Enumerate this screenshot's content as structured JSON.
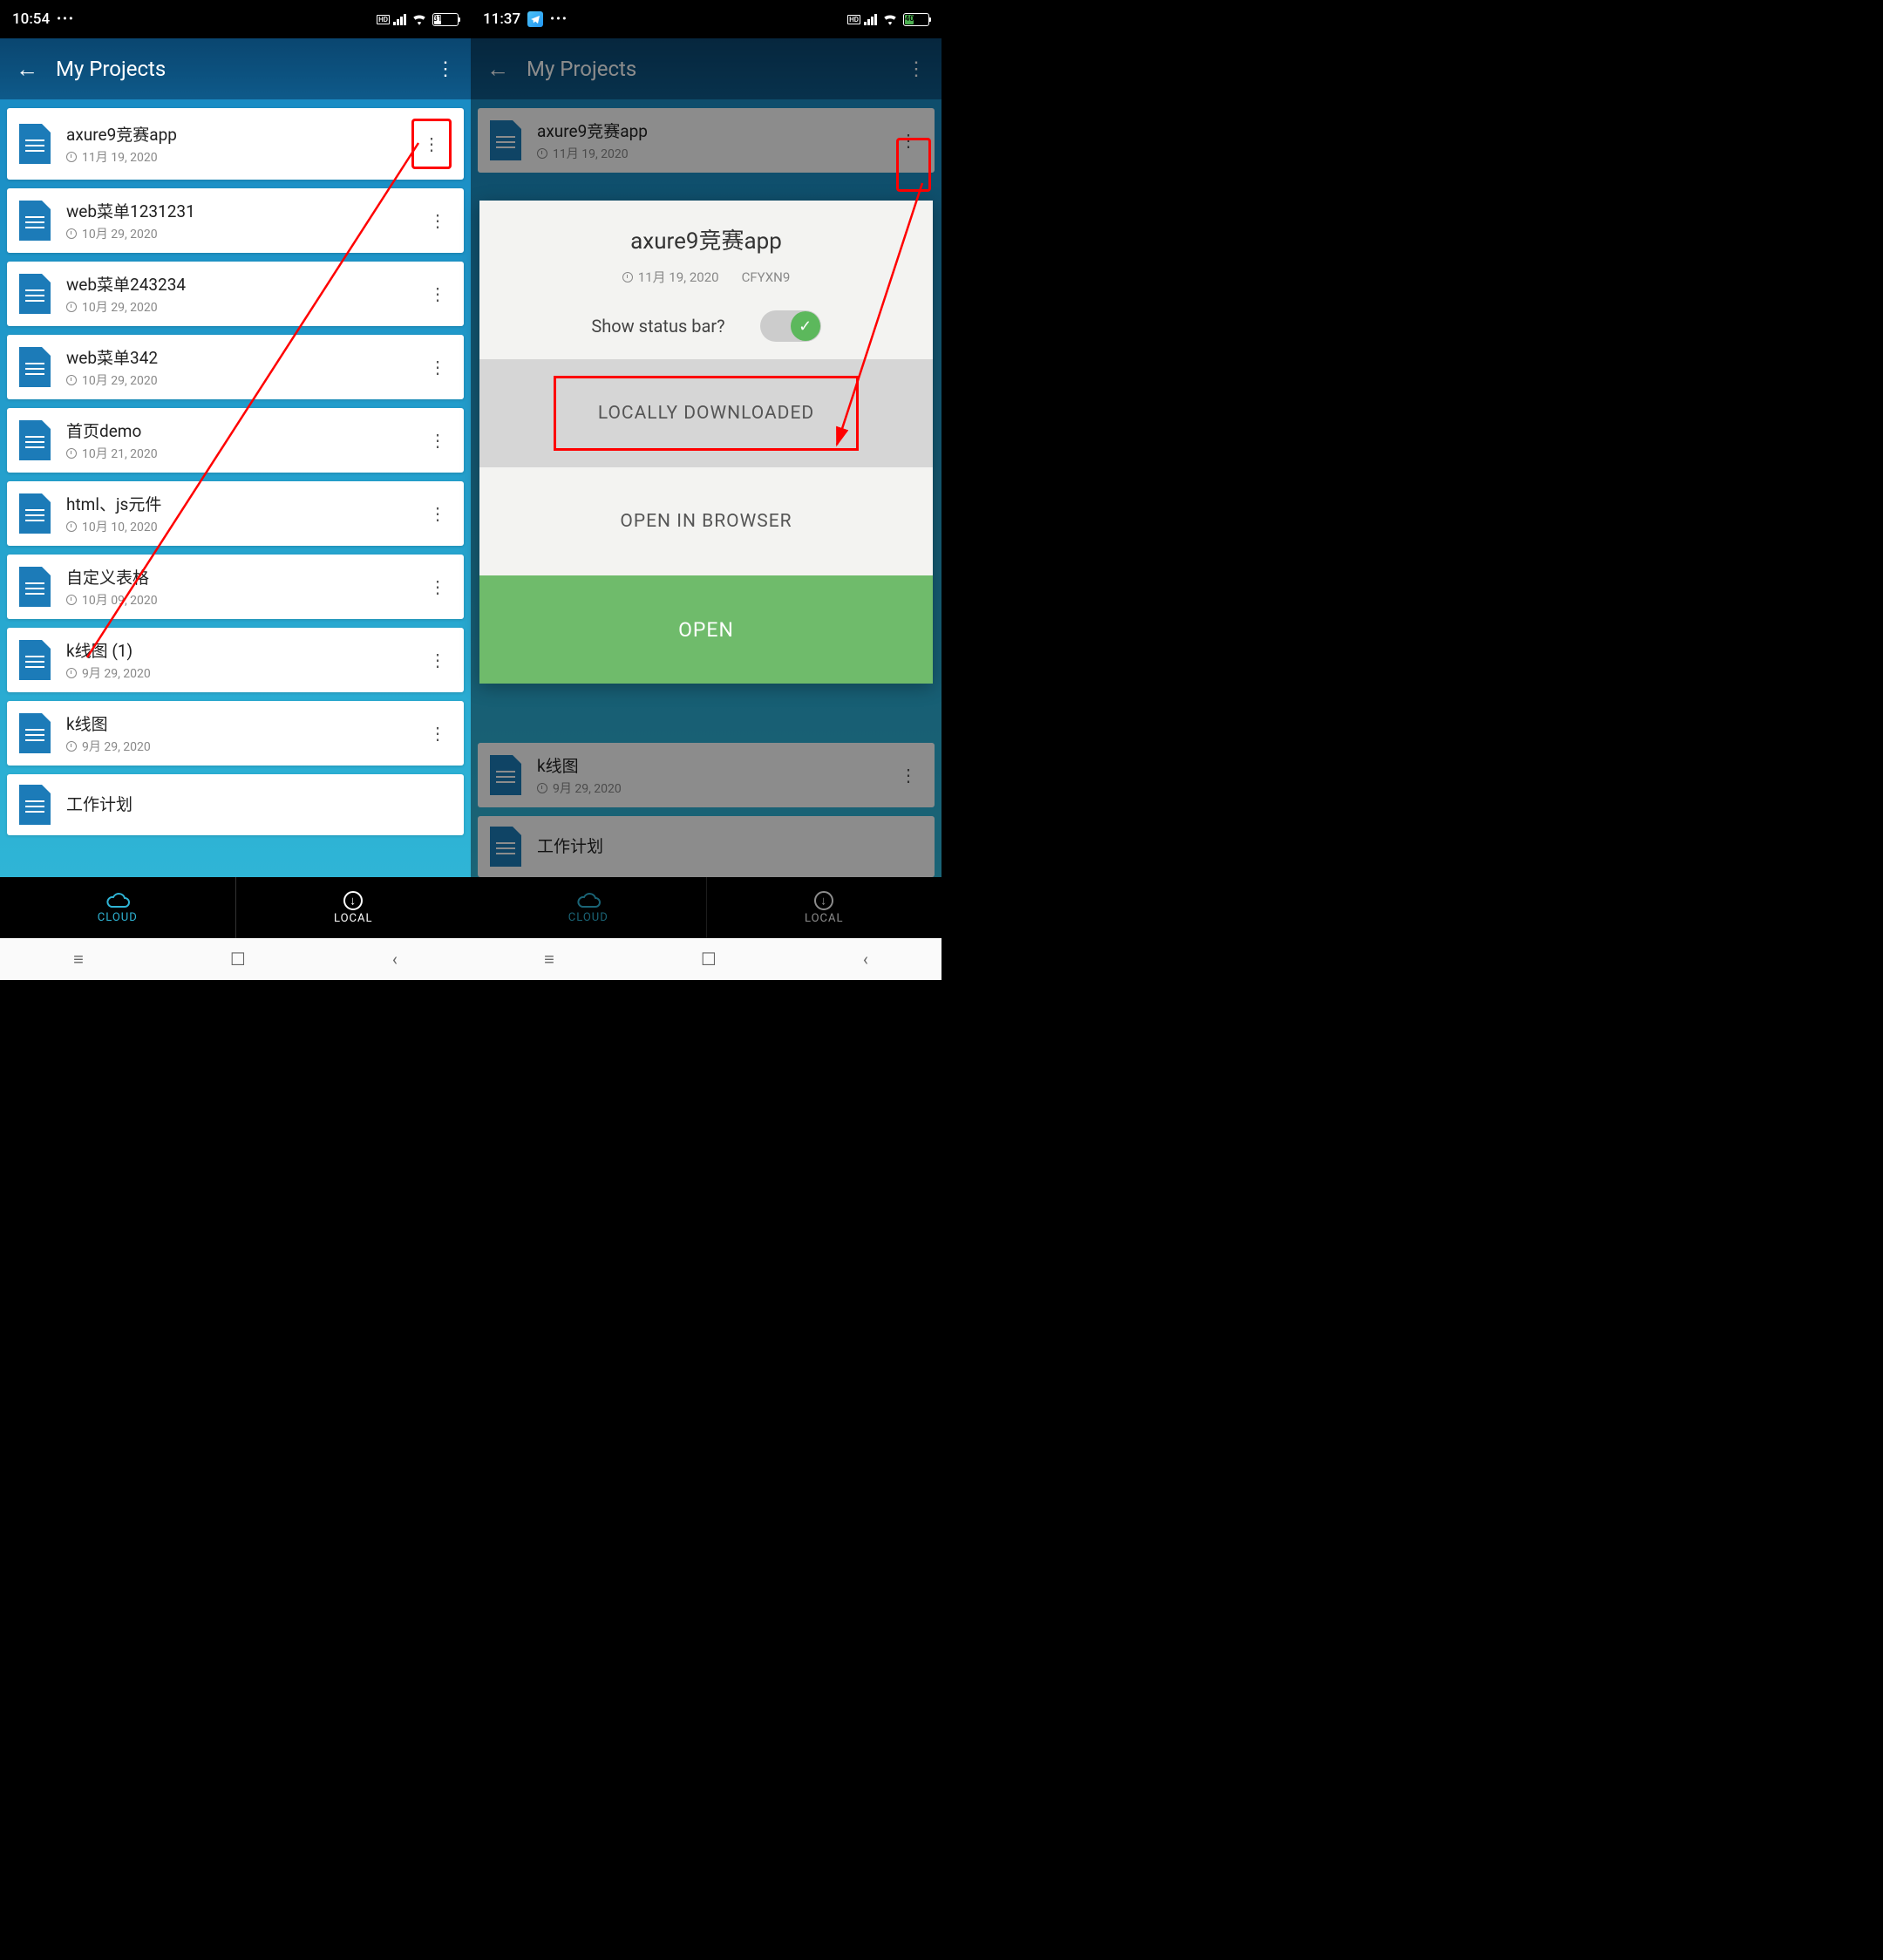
{
  "left": {
    "status": {
      "time": "10:54",
      "battery_pct": "31"
    },
    "header": {
      "title": "My Projects"
    },
    "projects": [
      {
        "title": "axure9竞赛app",
        "date": "11月 19, 2020"
      },
      {
        "title": "web菜单1231231",
        "date": "10月 29, 2020"
      },
      {
        "title": "web菜单243234",
        "date": "10月 29, 2020"
      },
      {
        "title": "web菜单342",
        "date": "10月 29, 2020"
      },
      {
        "title": "首页demo",
        "date": "10月 21, 2020"
      },
      {
        "title": "html、js元件",
        "date": "10月 10, 2020"
      },
      {
        "title": "自定义表格",
        "date": "10月 09, 2020"
      },
      {
        "title": "k线图 (1)",
        "date": "9月 29, 2020"
      },
      {
        "title": "k线图",
        "date": "9月 29, 2020"
      },
      {
        "title": "工作计划",
        "date": ""
      }
    ],
    "nav": {
      "cloud": "CLOUD",
      "local": "LOCAL"
    }
  },
  "right": {
    "status": {
      "time": "11:37",
      "battery_pct": "40"
    },
    "header": {
      "title": "My Projects"
    },
    "projects": [
      {
        "title": "axure9竞赛app",
        "date": "11月 19, 2020"
      },
      {
        "title": "k线图",
        "date": "9月 29, 2020"
      },
      {
        "title": "工作计划",
        "date": ""
      }
    ],
    "modal": {
      "title": "axure9竞赛app",
      "date": "11月 19, 2020",
      "code": "CFYXN9",
      "status_label": "Show status bar?",
      "btn_local": "LOCALLY DOWNLOADED",
      "btn_browser": "OPEN IN BROWSER",
      "btn_open": "OPEN"
    },
    "nav": {
      "cloud": "CLOUD",
      "local": "LOCAL"
    }
  }
}
